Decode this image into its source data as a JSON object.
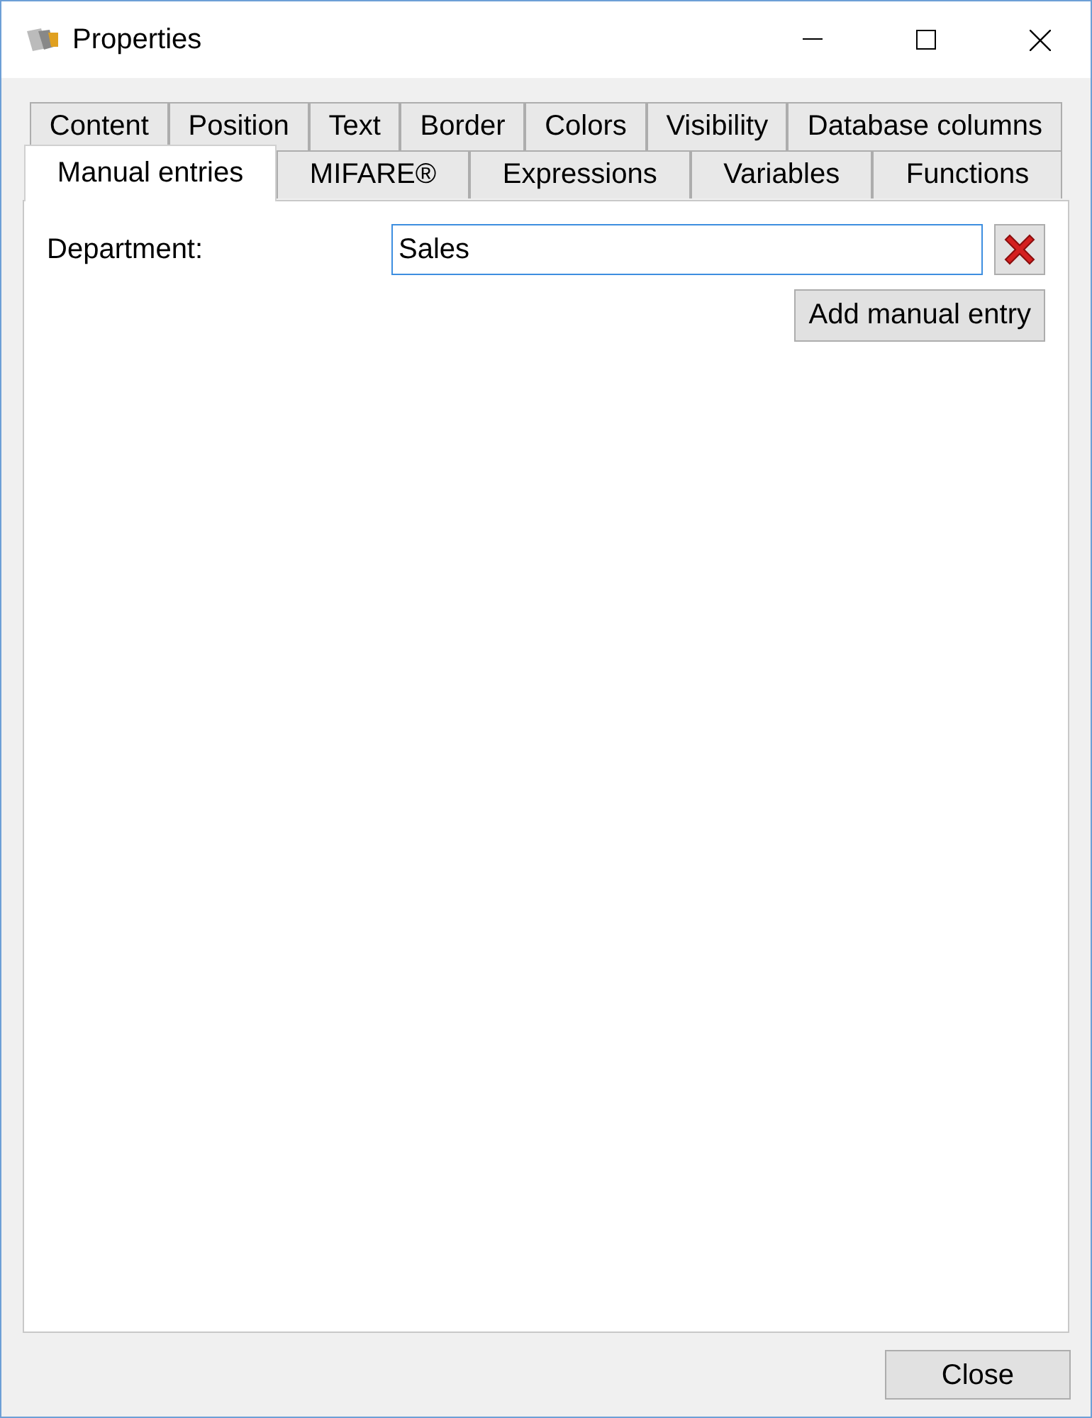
{
  "window": {
    "title": "Properties"
  },
  "tab_rows": [
    {
      "tabs": [
        {
          "label": "Content",
          "selected": false
        },
        {
          "label": "Position",
          "selected": false
        },
        {
          "label": "Text",
          "selected": false
        },
        {
          "label": "Border",
          "selected": false
        },
        {
          "label": "Colors",
          "selected": false
        },
        {
          "label": "Visibility",
          "selected": false
        },
        {
          "label": "Database columns",
          "selected": false
        }
      ]
    },
    {
      "tabs": [
        {
          "label": "Manual entries",
          "selected": true
        },
        {
          "label": "MIFARE®",
          "selected": false
        },
        {
          "label": "Expressions",
          "selected": false
        },
        {
          "label": "Variables",
          "selected": false
        },
        {
          "label": "Functions",
          "selected": false
        }
      ]
    }
  ],
  "entries": [
    {
      "label": "Department:",
      "value": "Sales",
      "focused": true
    }
  ],
  "add_button": "Add manual entry",
  "close_button": "Close"
}
